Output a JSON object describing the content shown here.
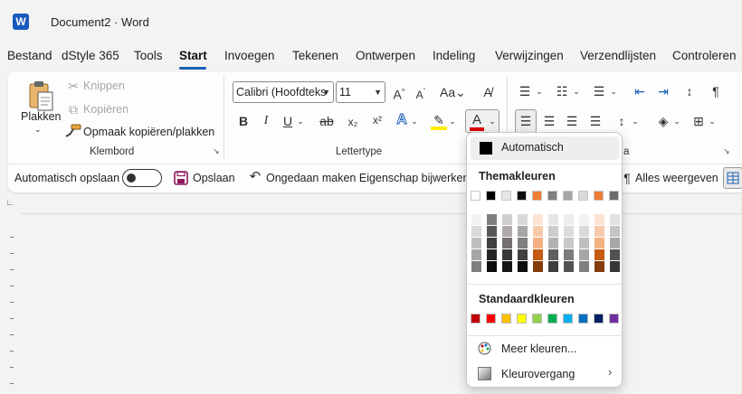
{
  "app": {
    "logo_letter": "W",
    "title": "Document2 · Word"
  },
  "tabs": [
    "Bestand",
    "dStyle 365",
    "Tools",
    "Start",
    "Invoegen",
    "Tekenen",
    "Ontwerpen",
    "Indeling",
    "Verwijzingen",
    "Verzendlijsten",
    "Controleren"
  ],
  "active_tab": "Start",
  "clipboard": {
    "paste": "Plakken",
    "cut": "Knippen",
    "copy": "Kopiëren",
    "format_painter": "Opmaak kopiëren/plakken",
    "group": "Klembord"
  },
  "font": {
    "name": "Calibri (Hoofdteks",
    "size": "11",
    "group": "Lettertype",
    "bold": "B",
    "italic": "I",
    "underline": "U",
    "strike": "ab",
    "subscript": "x₂",
    "superscript": "x²",
    "font_color_letter": "A",
    "font_color_hex": "#e00000",
    "highlight_hex": "#ffee00"
  },
  "paragraph": {
    "group_suffix": "a",
    "pilcrow": "¶"
  },
  "qat": {
    "autosave": "Automatisch opslaan",
    "save": "Opslaan",
    "undo": "Ongedaan maken Eigenschap bijwerken",
    "show_all": "Alles weergeven"
  },
  "color_panel": {
    "automatic": "Automatisch",
    "theme_heading": "Themakleuren",
    "standard_heading": "Standaardkleuren",
    "more_colors": "Meer kleuren...",
    "gradient": "Kleurovergang",
    "theme_colors": [
      "#ffffff",
      "#000000",
      "#e7e6e6",
      "#0e0e0e",
      "#ed7d31",
      "#7f7f7f",
      "#a5a5a5",
      "#d9d9d9",
      "#ed7d31",
      "#6d6d6d"
    ],
    "theme_shades": [
      [
        "#f2f2f2",
        "#d9d9d9",
        "#bfbfbf",
        "#a6a6a6",
        "#7f7f7f"
      ],
      [
        "#7f7f7f",
        "#595959",
        "#3f3f3f",
        "#262626",
        "#0d0d0d"
      ],
      [
        "#d0cece",
        "#afabab",
        "#767171",
        "#3a3838",
        "#171616"
      ],
      [
        "#d9d9d9",
        "#a6a6a6",
        "#7f7f7f",
        "#404040",
        "#0d0d0d"
      ],
      [
        "#fbe4d5",
        "#f7caac",
        "#f4b183",
        "#c55a11",
        "#843c0b"
      ],
      [
        "#e5e5e5",
        "#cccccc",
        "#b2b2b2",
        "#5f5f5f",
        "#3f3f3f"
      ],
      [
        "#ededed",
        "#dbdbdb",
        "#c9c9c9",
        "#7b7b7b",
        "#525252"
      ],
      [
        "#f2f2f2",
        "#d9d9d9",
        "#bfbfbf",
        "#a6a6a6",
        "#7f7f7f"
      ],
      [
        "#fbe4d5",
        "#f7caac",
        "#f4b183",
        "#c55a11",
        "#843c0b"
      ],
      [
        "#e2e2e2",
        "#c5c5c5",
        "#a8a8a8",
        "#525252",
        "#363636"
      ]
    ],
    "standard_colors": [
      "#c00000",
      "#ff0000",
      "#ffc000",
      "#ffff00",
      "#92d050",
      "#00b050",
      "#00b0f0",
      "#0070c0",
      "#002060",
      "#7030a0"
    ]
  }
}
